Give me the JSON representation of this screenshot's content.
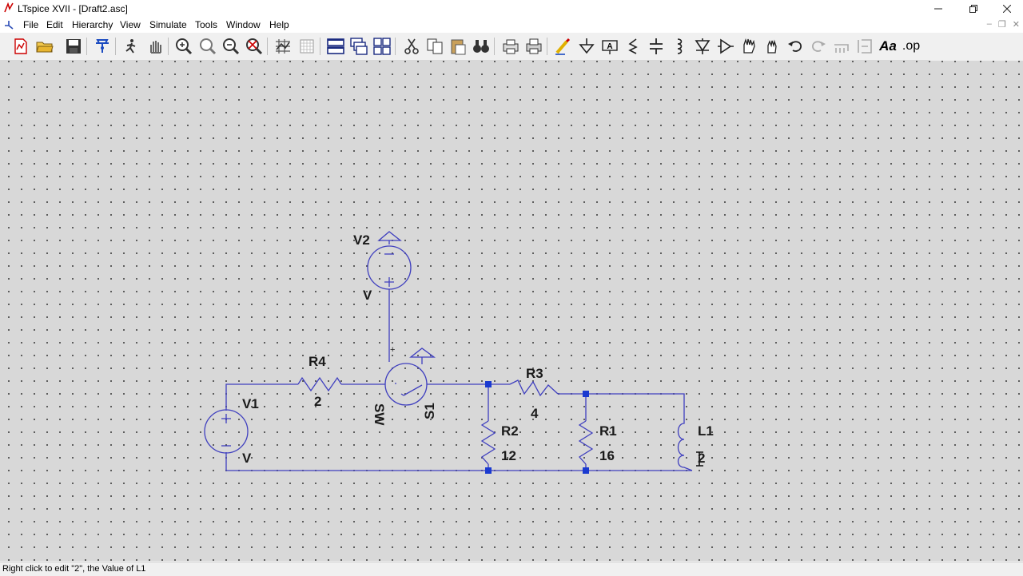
{
  "window": {
    "title": "LTspice XVII - [Draft2.asc]",
    "controls": [
      "minimize",
      "restore",
      "close"
    ]
  },
  "menu": {
    "items": [
      {
        "label": "File"
      },
      {
        "label": "Edit"
      },
      {
        "label": "Hierarchy"
      },
      {
        "label": "View"
      },
      {
        "label": "Simulate"
      },
      {
        "label": "Tools"
      },
      {
        "label": "Window"
      },
      {
        "label": "Help"
      }
    ]
  },
  "toolbar": {
    "tools": [
      "new-schematic-icon",
      "open-icon",
      "save-icon",
      "control-panel-icon",
      "run-icon",
      "halt-icon",
      "zoom-in-icon",
      "zoom-pan-icon",
      "zoom-out-icon",
      "zoom-fit-icon",
      "autorange-icon",
      "grid-icon",
      "tile-vertical-icon",
      "cascade-icon",
      "tile-horizontal-icon",
      "cut-icon",
      "copy-icon",
      "paste-icon",
      "find-icon",
      "print-setup-icon",
      "print-icon",
      "wire-icon",
      "ground-icon",
      "label-net-icon",
      "resistor-icon",
      "capacitor-icon",
      "inductor-icon",
      "diode-icon",
      "component-icon",
      "move-icon",
      "drag-icon",
      "undo-icon",
      "redo-icon",
      "rotate-icon",
      "mirror-icon",
      "text-icon",
      "spice-directive-icon"
    ],
    "text_tool_label": "Aa",
    "op_label": ".op"
  },
  "schematic": {
    "components": [
      {
        "ref": "V2",
        "value": "V"
      },
      {
        "ref": "V1",
        "value": "V"
      },
      {
        "ref": "R4",
        "value": "2"
      },
      {
        "ref": "R3",
        "value": "4"
      },
      {
        "ref": "R2",
        "value": "12"
      },
      {
        "ref": "R1",
        "value": "16"
      },
      {
        "ref": "L1",
        "value": "2"
      },
      {
        "ref": "S1",
        "value": "SW"
      }
    ],
    "switch_plus": "+"
  },
  "status": {
    "text": "Right click to edit \"2\", the Value of L1"
  },
  "colors": {
    "wire": "#3f3fbf",
    "junction": "#1a3ad0",
    "canvas": "#d8d8d8",
    "grid_dot": "#4a4a4a"
  }
}
